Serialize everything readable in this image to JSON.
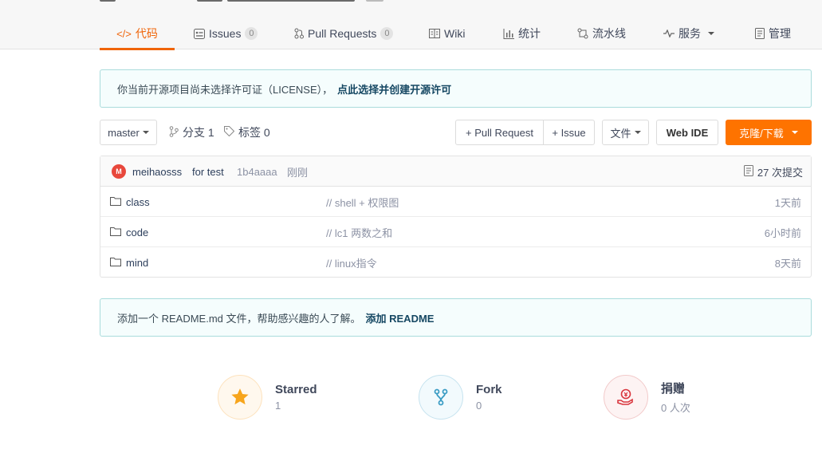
{
  "tabs": [
    {
      "label": "代码",
      "icon": "code-icon"
    },
    {
      "label": "Issues",
      "icon": "issues-icon",
      "count": "0"
    },
    {
      "label": "Pull Requests",
      "icon": "pull-request-icon",
      "count": "0"
    },
    {
      "label": "Wiki",
      "icon": "wiki-icon"
    },
    {
      "label": "统计",
      "icon": "stats-icon"
    },
    {
      "label": "流水线",
      "icon": "pipeline-icon"
    },
    {
      "label": "服务",
      "icon": "service-icon"
    },
    {
      "label": "管理",
      "icon": "manage-icon"
    }
  ],
  "license_notice": {
    "text": "你当前开源项目尚未选择许可证（LICENSE），",
    "link": "点此选择并创建开源许可"
  },
  "toolbar": {
    "branch": "master",
    "branches_label": "分支 1",
    "tags_label": "标签 0",
    "pull_request": "+ Pull Request",
    "issue": "+ Issue",
    "file": "文件",
    "web_ide": "Web IDE",
    "clone": "克隆/下载"
  },
  "commit": {
    "avatar": "M",
    "author": "meihaosss",
    "message": "for test",
    "hash": "1b4aaaa",
    "time": "刚刚",
    "count_label": "27 次提交"
  },
  "files": [
    {
      "name": "class",
      "message": "// shell + 权限图",
      "time": "1天前"
    },
    {
      "name": "code",
      "message": "// lc1 两数之和",
      "time": "6小时前"
    },
    {
      "name": "mind",
      "message": "// linux指令",
      "time": "8天前"
    }
  ],
  "readme_notice": {
    "text": "添加一个 README.md 文件，帮助感兴趣的人了解。",
    "link": "添加 README"
  },
  "stats": [
    {
      "label": "Starred",
      "value": "1",
      "icon": "star-icon"
    },
    {
      "label": "Fork",
      "value": "0",
      "icon": "fork-icon"
    },
    {
      "label": "捐赠",
      "value": "0 人次",
      "icon": "donate-icon"
    }
  ],
  "colors": {
    "accent": "#f0650a",
    "clone_button": "#fe7300",
    "notice_border": "#aadcdc",
    "notice_bg": "#f5fdfd"
  }
}
